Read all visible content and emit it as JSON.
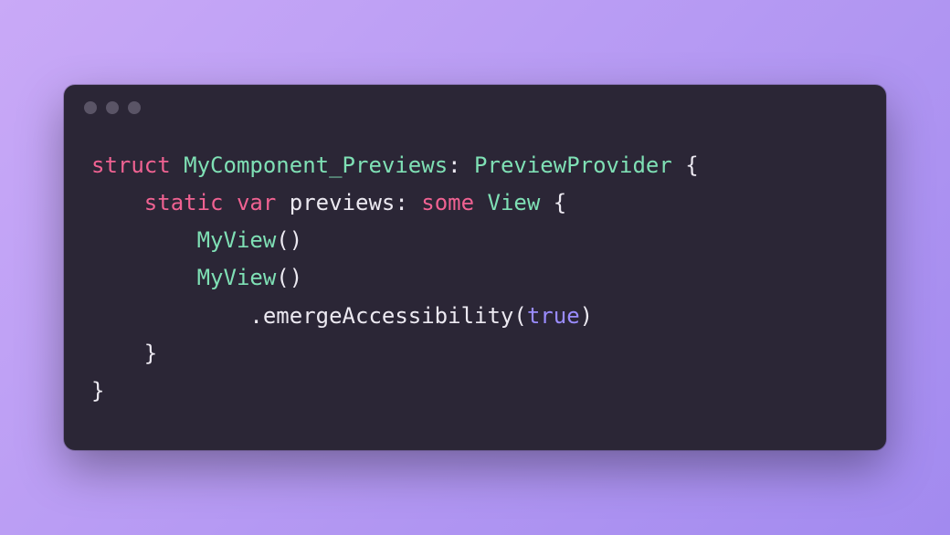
{
  "code": {
    "tokens": {
      "kw_struct": "struct",
      "type_name": "MyComponent_Previews",
      "colon1": ":",
      "protocol": "PreviewProvider",
      "brace_open1": "{",
      "kw_static": "static",
      "kw_var": "var",
      "previews": "previews",
      "colon2": ":",
      "kw_some": "some",
      "type_view": "View",
      "brace_open2": "{",
      "myview1": "MyView",
      "parens1": "()",
      "myview2": "MyView",
      "parens2": "()",
      "dot": ".",
      "method": "emergeAccessibility",
      "paren_open": "(",
      "bool_true": "true",
      "paren_close": ")",
      "brace_close2": "}",
      "brace_close1": "}"
    },
    "indent": {
      "l1": "    ",
      "l2": "        ",
      "l3": "            "
    }
  }
}
